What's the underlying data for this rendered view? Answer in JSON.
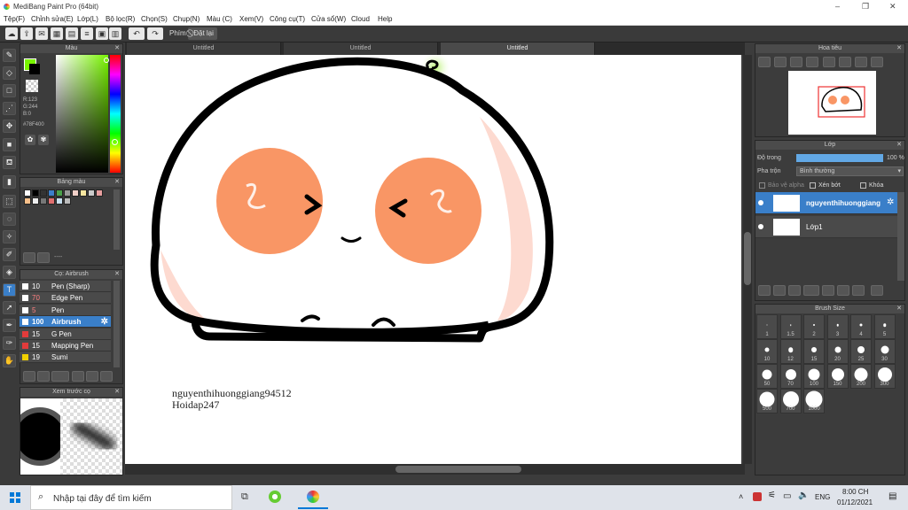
{
  "app": {
    "title": "MediBang Paint Pro (64bit)"
  },
  "window_buttons": [
    "–",
    "❐",
    "✕"
  ],
  "menu": [
    "Tệp(F)",
    "Chỉnh sửa(E)",
    "Lớp(L)",
    "Bộ lọc(R)",
    "Chọn(S)",
    "Chụp(N)",
    "Màu (C)",
    "Xem(V)",
    "Công cụ(T)",
    "Cửa sổ(W)",
    "Cloud",
    "Help"
  ],
  "toolbar": {
    "key_label": "Phím",
    "reset_label": "Đặt lại"
  },
  "tabs": [
    "Untitled",
    "Untitled",
    "Untitled"
  ],
  "color_panel": {
    "title": "Màu",
    "r": "R:123",
    "g": "G:244",
    "b": "B:0",
    "hex": "#78F400",
    "fg": "#78f400",
    "bg": "#000000"
  },
  "palette_panel": {
    "title": "Bảng màu",
    "dashes": "----",
    "colors": [
      "#ffffff",
      "#000000",
      "#333333",
      "#3c7fc9",
      "#4aa04a",
      "#999999",
      "#f2d0c8",
      "#f6e6a0",
      "#cccccc",
      "#e8a0a0",
      "#f7c08a",
      "#eeeeee",
      "#777777",
      "#e07070",
      "#c8e0f0",
      "#bbbbbb"
    ]
  },
  "brush_panel": {
    "title": "Cọ: Airbrush",
    "items": [
      {
        "size": "10",
        "name": "Pen (Sharp)",
        "color": "#ffffff",
        "size_color": "#ffffff"
      },
      {
        "size": "70",
        "name": "Edge Pen",
        "color": "#ffffff",
        "size_color": "#ff8080"
      },
      {
        "size": "5",
        "name": "Pen",
        "color": "#ffffff",
        "size_color": "#ff8080"
      },
      {
        "size": "100",
        "name": "Airbrush",
        "color": "#ffffff",
        "size_color": "#ffffff"
      },
      {
        "size": "15",
        "name": "G Pen",
        "color": "#e23b3b",
        "size_color": "#ffffff"
      },
      {
        "size": "15",
        "name": "Mapping Pen",
        "color": "#e23b3b",
        "size_color": "#ffffff"
      },
      {
        "size": "19",
        "name": "Sumi",
        "color": "#f0d000",
        "size_color": "#ffffff"
      }
    ]
  },
  "preview_panel": {
    "title": "Xem trước cọ"
  },
  "navigator_panel": {
    "title": "Hoa tiêu"
  },
  "layer_panel": {
    "title": "Lớp",
    "opacity_label": "Độ trong",
    "opacity_value": "100 %",
    "blend_label": "Pha trộn",
    "blend_value": "Bình thường",
    "protect_alpha": "Bảo vệ alpha",
    "clip": "Xén bớt",
    "lock": "Khóa",
    "layers": [
      {
        "name": "nguyenthihuonggiang",
        "selected": true
      },
      {
        "name": "Lớp1",
        "selected": false
      }
    ]
  },
  "brush_size_panel": {
    "title": "Brush Size",
    "sizes": [
      "1",
      "1.5",
      "2",
      "3",
      "4",
      "5",
      "10",
      "12",
      "15",
      "20",
      "25",
      "30",
      "50",
      "70",
      "100",
      "150",
      "200",
      "300",
      "500",
      "700",
      "1000"
    ]
  },
  "canvas": {
    "watermark_line1": "nguyenthihuonggiang94512",
    "watermark_line2": "Hoidap247"
  },
  "taskbar": {
    "search_placeholder": "Nhập tại đây để tìm kiếm",
    "lang": "ENG",
    "time": "8:00 CH",
    "date": "01/12/2021"
  }
}
